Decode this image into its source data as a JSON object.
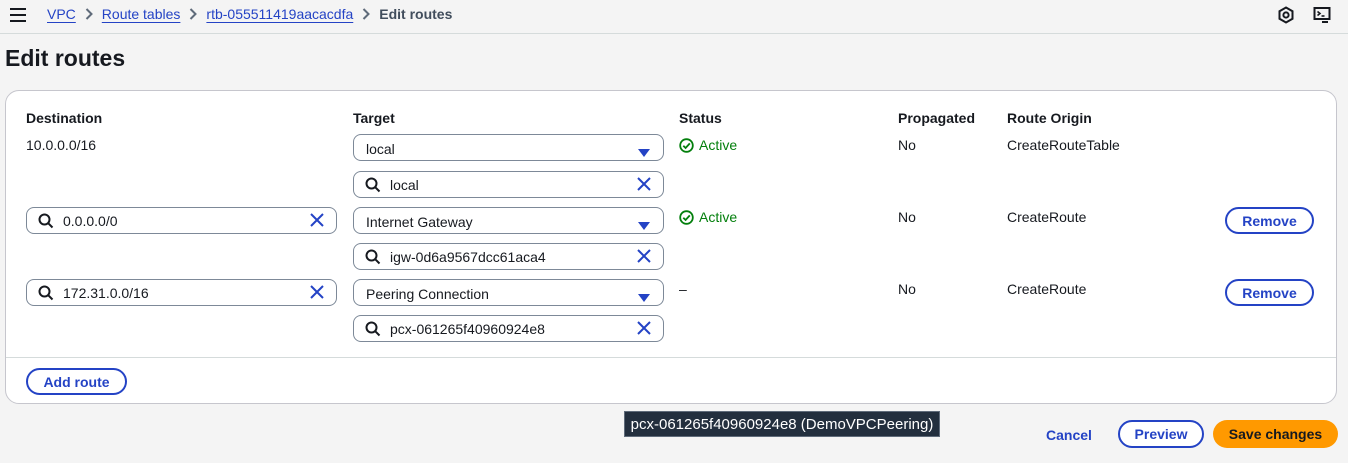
{
  "breadcrumb": {
    "items": [
      "VPC",
      "Route tables",
      "rtb-055511419aacacdfa"
    ],
    "current": "Edit routes"
  },
  "top_icons": [
    "hexagon-settings-icon",
    "cloudshell-icon"
  ],
  "page": {
    "title": "Edit routes"
  },
  "table": {
    "columns": [
      "Destination",
      "Target",
      "Status",
      "Propagated",
      "Route Origin"
    ],
    "rows": [
      {
        "destination": "10.0.0.0/16",
        "target_type": "local",
        "target_value": "local",
        "status": "Active",
        "propagated": "No",
        "origin": "CreateRouteTable"
      },
      {
        "destination": "0.0.0.0/0",
        "target_type": "Internet Gateway",
        "target_value": "igw-0d6a9567dcc61aca4",
        "status": "Active",
        "propagated": "No",
        "origin": "CreateRoute",
        "remove_label": "Remove"
      },
      {
        "destination": "172.31.0.0/16",
        "target_type": "Peering Connection",
        "target_value": "pcx-061265f40960924e8",
        "status": "–",
        "propagated": "No",
        "origin": "CreateRoute",
        "remove_label": "Remove"
      }
    ],
    "add_route_label": "Add route"
  },
  "tooltip": {
    "text": "pcx-061265f40960924e8 (DemoVPCPeering)"
  },
  "footer": {
    "cancel_label": "Cancel",
    "preview_label": "Preview",
    "save_label": "Save changes"
  },
  "colors": {
    "link": "#2443c5",
    "success": "#037f0c",
    "primary": "#ff9900"
  }
}
